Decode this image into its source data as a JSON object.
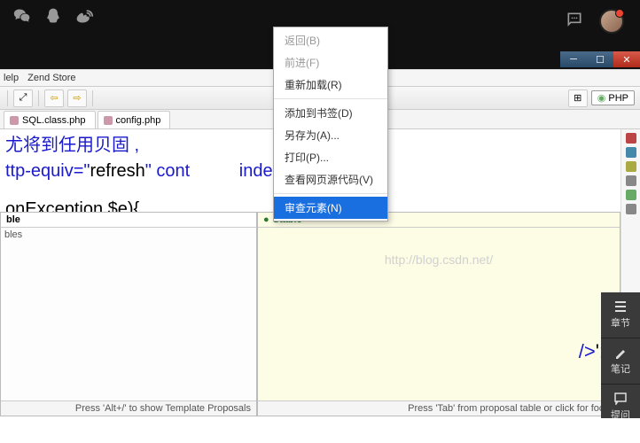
{
  "topbar": {
    "chat_icon": "chat"
  },
  "window_controls": {
    "min": "─",
    "max": "☐",
    "close": "✕"
  },
  "menu": {
    "help": "lelp",
    "zend": "Zend Store"
  },
  "phpBadge": "PHP",
  "tabs": [
    {
      "label": "SQL.class.php"
    },
    {
      "label": "config.php"
    }
  ],
  "code": {
    "line1_tail": "尤将到任用贝固 ,",
    "line2_pre": "ttp-equiv=\"",
    "line2_kw": "refresh",
    "line2_mid": "\" cont",
    "line2_end": "index.php#toregis",
    "line3": "onException $e){",
    "tail_a": "/>",
    "tail_b": "';"
  },
  "leftPanel": {
    "tab": "ble",
    "row": "bles",
    "footer": "Press 'Alt+/' to show Template Proposals"
  },
  "rightPanel": {
    "tab": "Stable",
    "footer": "Press 'Tab' from proposal table or click for focus"
  },
  "watermark": "http://blog.csdn.net/",
  "contextMenu": {
    "items": [
      {
        "label": "返回(B)",
        "enabled": false
      },
      {
        "label": "前进(F)",
        "enabled": false
      },
      {
        "label": "重新加载(R)",
        "enabled": true
      },
      {
        "sep": true
      },
      {
        "label": "添加到书签(D)",
        "enabled": true
      },
      {
        "label": "另存为(A)...",
        "enabled": true
      },
      {
        "label": "打印(P)...",
        "enabled": true
      },
      {
        "label": "查看网页源代码(V)",
        "enabled": true
      },
      {
        "sep": true
      },
      {
        "label": "审查元素(N)",
        "enabled": true,
        "selected": true
      }
    ]
  },
  "dock": [
    {
      "label": "章节"
    },
    {
      "label": "笔记"
    },
    {
      "label": "提问"
    }
  ]
}
